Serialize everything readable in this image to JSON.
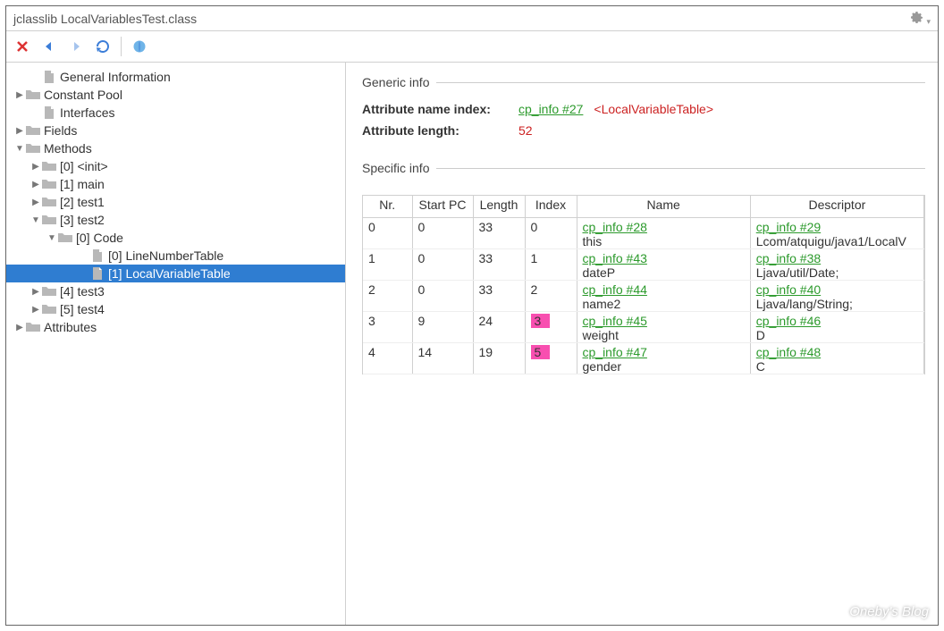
{
  "title": "jclasslib LocalVariablesTest.class",
  "tree": [
    {
      "d": 1,
      "tw": "",
      "icon": "file",
      "label": "General Information"
    },
    {
      "d": 0,
      "tw": ">",
      "icon": "folder",
      "label": "Constant Pool"
    },
    {
      "d": 1,
      "tw": "",
      "icon": "file",
      "label": "Interfaces"
    },
    {
      "d": 0,
      "tw": ">",
      "icon": "folder",
      "label": "Fields"
    },
    {
      "d": 0,
      "tw": "v",
      "icon": "folder",
      "label": "Methods"
    },
    {
      "d": 1,
      "tw": ">",
      "icon": "folder",
      "label": "[0] <init>"
    },
    {
      "d": 1,
      "tw": ">",
      "icon": "folder",
      "label": "[1] main"
    },
    {
      "d": 1,
      "tw": ">",
      "icon": "folder",
      "label": "[2] test1"
    },
    {
      "d": 1,
      "tw": "v",
      "icon": "folder",
      "label": "[3] test2"
    },
    {
      "d": 2,
      "tw": "v",
      "icon": "folder",
      "label": "[0] Code"
    },
    {
      "d": 4,
      "tw": "",
      "icon": "file",
      "label": "[0] LineNumberTable"
    },
    {
      "d": 4,
      "tw": "",
      "icon": "file",
      "label": "[1] LocalVariableTable",
      "sel": true
    },
    {
      "d": 1,
      "tw": ">",
      "icon": "folder",
      "label": "[4] test3"
    },
    {
      "d": 1,
      "tw": ">",
      "icon": "folder",
      "label": "[5] test4"
    },
    {
      "d": 0,
      "tw": ">",
      "icon": "folder",
      "label": "Attributes"
    }
  ],
  "generic": {
    "heading": "Generic info",
    "attr_name_label": "Attribute name index:",
    "attr_name_link": "cp_info #27",
    "attr_name_tag": "<LocalVariableTable>",
    "attr_len_label": "Attribute length:",
    "attr_len_value": "52"
  },
  "specific": {
    "heading": "Specific info",
    "columns": [
      "Nr.",
      "Start PC",
      "Length",
      "Index",
      "Name",
      "Descriptor"
    ],
    "rows": [
      {
        "nr": "0",
        "start": "0",
        "len": "33",
        "idx": "0",
        "name_link": "cp_info #28",
        "name_val": "this",
        "desc_link": "cp_info #29",
        "desc_val": "Lcom/atquigu/java1/LocalV",
        "hi": false
      },
      {
        "nr": "1",
        "start": "0",
        "len": "33",
        "idx": "1",
        "name_link": "cp_info #43",
        "name_val": "dateP",
        "desc_link": "cp_info #38",
        "desc_val": "Ljava/util/Date;",
        "hi": false
      },
      {
        "nr": "2",
        "start": "0",
        "len": "33",
        "idx": "2",
        "name_link": "cp_info #44",
        "name_val": "name2",
        "desc_link": "cp_info #40",
        "desc_val": "Ljava/lang/String;",
        "hi": false
      },
      {
        "nr": "3",
        "start": "9",
        "len": "24",
        "idx": "3",
        "name_link": "cp_info #45",
        "name_val": "weight",
        "desc_link": "cp_info #46",
        "desc_val": "D",
        "hi": true
      },
      {
        "nr": "4",
        "start": "14",
        "len": "19",
        "idx": "5",
        "name_link": "cp_info #47",
        "name_val": "gender",
        "desc_link": "cp_info #48",
        "desc_val": "C",
        "hi": true
      }
    ]
  },
  "watermark": "Oneby's Blog"
}
